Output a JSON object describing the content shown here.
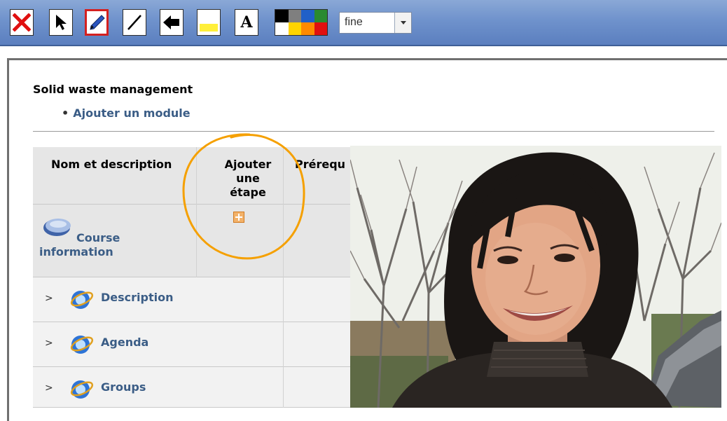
{
  "toolbar": {
    "buttons": [
      {
        "name": "close",
        "icon": "close-x-icon"
      },
      {
        "name": "select",
        "icon": "cursor-arrow-icon"
      },
      {
        "name": "pen",
        "icon": "pen-icon",
        "active": true
      },
      {
        "name": "line",
        "icon": "line-icon"
      },
      {
        "name": "arrow",
        "icon": "arrow-left-icon"
      },
      {
        "name": "highlighter",
        "icon": "highlighter-icon"
      },
      {
        "name": "text",
        "icon": "text-a-icon",
        "label": "A"
      }
    ],
    "palette_colors": [
      "#000000",
      "#7f7f7f",
      "#2060c8",
      "#2a8a30",
      "#ffffff",
      "#ffd400",
      "#ff8a00",
      "#e01010"
    ],
    "stroke_width": "fine",
    "accent_active": "#d42020"
  },
  "page": {
    "course_title": "Solid waste management",
    "add_module": "Ajouter un module",
    "table": {
      "headers": {
        "name": "Nom et description",
        "add_step_line1": "Ajouter",
        "add_step_line2": "une étape",
        "prereq": "Prérequ"
      },
      "course_row": {
        "line1": "Course",
        "line2": "information"
      },
      "rows": [
        {
          "arrow": ">",
          "label": "Description"
        },
        {
          "arrow": ">",
          "label": "Agenda"
        },
        {
          "arrow": ">",
          "label": "Groups"
        }
      ]
    }
  },
  "colors": {
    "link": "#3b5d86",
    "annotation_stroke": "#f5a000",
    "toolbar_bg": "#6f92cc"
  }
}
